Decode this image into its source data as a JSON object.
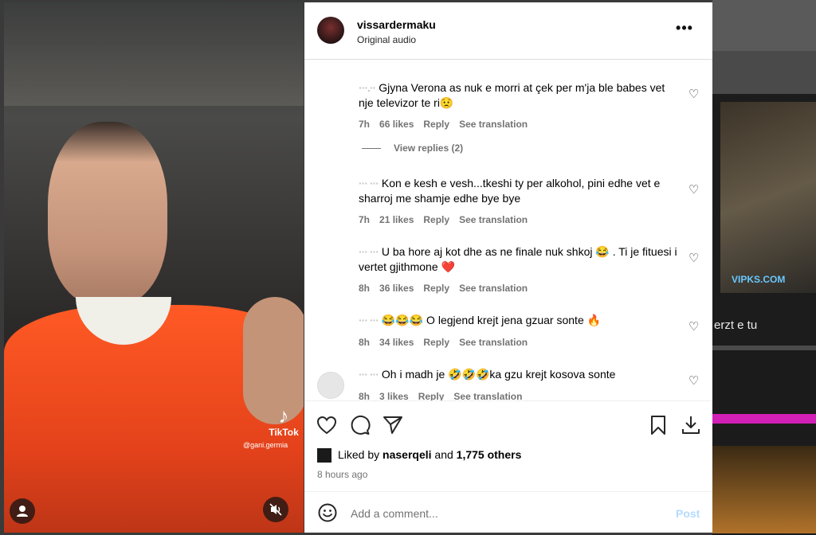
{
  "header": {
    "username": "vissardermaku",
    "audio": "Original audio",
    "more_label": "•••"
  },
  "video": {
    "tiktok_brand": "TikTok",
    "tiktok_user": "@gani.germia",
    "tiktok_icon": "♪"
  },
  "background": {
    "logo": "VIPKS.COM",
    "caption": "erzt e tu"
  },
  "comments": [
    {
      "user": "···.··",
      "text": "Gjyna Verona as nuk e morri at çek per m'ja ble babes vet nje televizor te ri😟",
      "time": "7h",
      "likes": "66 likes",
      "reply": "Reply",
      "translate": "See translation"
    },
    {
      "user": "··· ···",
      "text": "Kon e kesh e vesh...tkeshi ty per alkohol, pini edhe vet e sharroj me shamje edhe bye bye",
      "time": "7h",
      "likes": "21 likes",
      "reply": "Reply",
      "translate": "See translation"
    },
    {
      "user": "··· ···",
      "text": "U ba hore aj kot dhe as ne finale nuk shkoj 😂 . Ti je fituesi i vertet gjithmone ❤️",
      "time": "8h",
      "likes": "36 likes",
      "reply": "Reply",
      "translate": "See translation"
    },
    {
      "user": "··· ···",
      "text": "😂😂😂 O legjend krejt jena gzuar sonte 🔥",
      "time": "8h",
      "likes": "34 likes",
      "reply": "Reply",
      "translate": "See translation"
    },
    {
      "user": "··· ···",
      "text": "Oh i madh je 🤣🤣🤣ka gzu krejt kosova sonte",
      "time": "8h",
      "likes": "3 likes",
      "reply": "Reply",
      "translate": "See translation"
    }
  ],
  "view_replies": "View replies (2)",
  "likes": {
    "prefix": "Liked by",
    "user": "naserqeli",
    "and": "and",
    "others": "1,775 others"
  },
  "time_ago": "8 hours ago",
  "add_comment": {
    "placeholder": "Add a comment...",
    "post_label": "Post"
  },
  "colors": {
    "link": "#0095f6",
    "post_disabled": "#b3dbff",
    "heart_red": "#e0245e"
  }
}
